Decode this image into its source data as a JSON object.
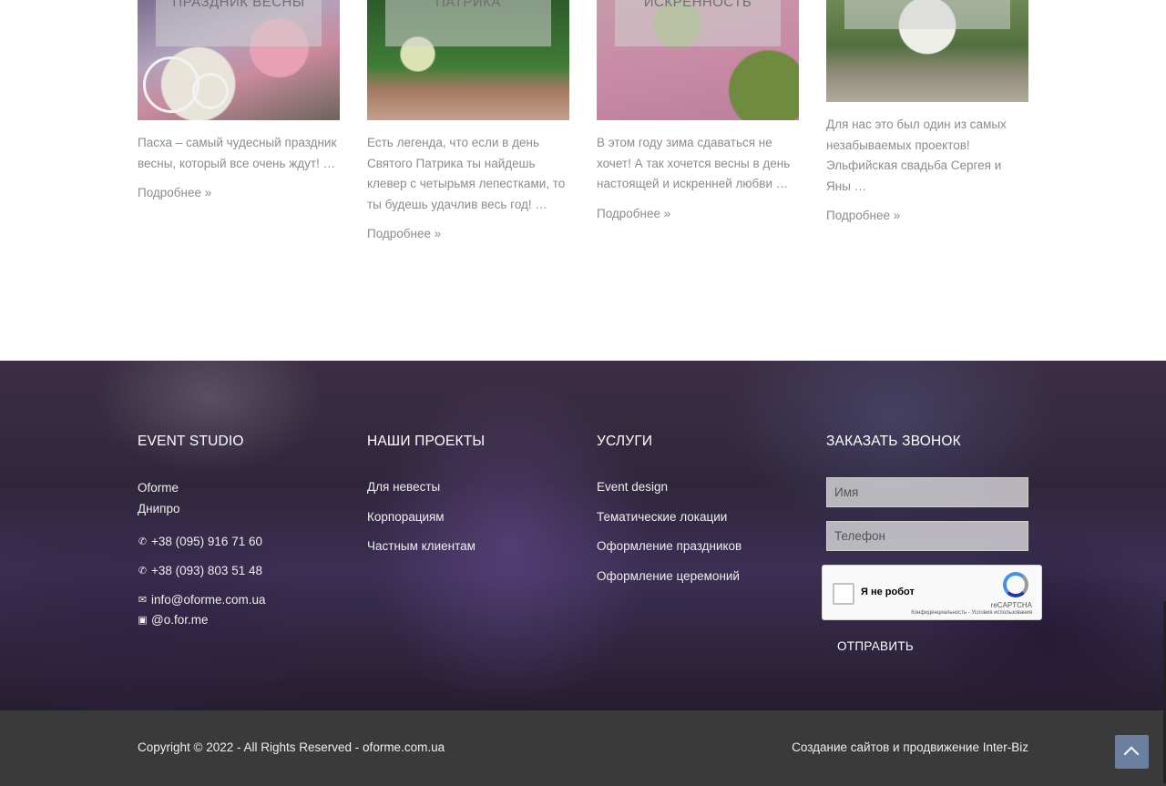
{
  "cards": [
    {
      "overlay_title": "ПРАЗДНИК ВЕСНЫ",
      "excerpt": "Пасха – самый чудесный праздник весны, который все очень ждут! …",
      "more": "Подробнее »"
    },
    {
      "overlay_title": "ПАТРИКА",
      "excerpt": "Есть легенда, что если в день Святого Патрика ты найдешь клевер с четырьмя лепестками, то ты будешь удачлив весь год! …",
      "more": "Подробнее »"
    },
    {
      "overlay_title": "ИСКРЕННОСТЬ",
      "excerpt": "В этом году зима сдаваться не хочет! А так хочется весны в день настоящей и искренней любви …",
      "more": "Подробнее »"
    },
    {
      "overlay_title": "",
      "excerpt": "Для нас это был один из самых незабываемых проектов! Эльфийская свадьба Сергея и Яны …",
      "more": "Подробнее »"
    }
  ],
  "footer": {
    "studio": {
      "title": "EVENT STUDIO",
      "name": "Oforme",
      "city": "Днипро",
      "phone1": "+38 (095) 916 71 60",
      "phone2": "+38 (093) 803 51 48",
      "email": "info@oforme.com.ua",
      "instagram": "@o.for.me",
      "icons": {
        "phone": "phone-icon",
        "email": "envelope-icon",
        "instagram": "instagram-icon"
      }
    },
    "projects": {
      "title": "НАШИ ПРОЕКТЫ",
      "links": [
        "Для невесты",
        "Корпорациям",
        "Частным клиентам"
      ]
    },
    "services": {
      "title": "УСЛУГИ",
      "links": [
        "Event design",
        "Тематические локации",
        "Оформление праздников",
        "Оформление церемоний"
      ]
    },
    "callback": {
      "title": "ЗАКАЗАТЬ ЗВОНОК",
      "name_placeholder": "Имя",
      "phone_placeholder": "Телефон",
      "recaptcha_label": "Я не робот",
      "recaptcha_brand": "reCAPTCHA",
      "recaptcha_terms": "Конфиденциальность - Условия использования",
      "submit": "ОТПРАВИТЬ"
    }
  },
  "bottom": {
    "copyright": "Copyright © 2022 - All Rights Reserved - oforme.com.ua",
    "credit": "Создание сайтов и продвижение Inter-Biz"
  },
  "colors": {
    "bottom_bar": "#3a3a3a",
    "to_top_button": "#6b7f9e",
    "text_muted": "#8c8c8c"
  }
}
